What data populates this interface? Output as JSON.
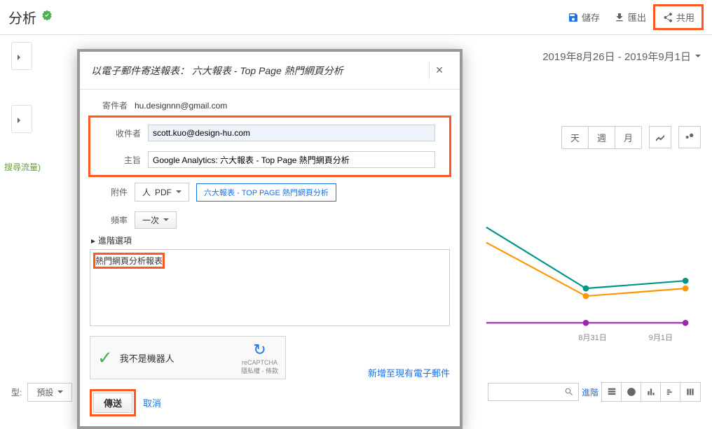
{
  "header": {
    "title": "分析",
    "save": "儲存",
    "export": "匯出",
    "share": "共用"
  },
  "date_range": "2019年8月26日 - 2019年9月1日",
  "segments": {
    "day": "天",
    "week": "週",
    "month": "月"
  },
  "legend": "搜尋流量)",
  "x_labels": [
    "8月31日",
    "9月1日"
  ],
  "bottom": {
    "type_label": "型:",
    "type_value": "預設",
    "advanced": "進階"
  },
  "modal": {
    "title_prefix": "以電子郵件寄送報表：",
    "title_report": "六大報表 - Top Page 熱門網頁分析",
    "labels": {
      "from": "寄件者",
      "to": "收件者",
      "subject": "主旨",
      "attachment": "附件",
      "frequency": "頻率"
    },
    "from_value": "hu.designnn@gmail.com",
    "to_value": "scott.kuo@design-hu.com",
    "subject_value": "Google Analytics: 六大報表 - Top Page 熱門網頁分析",
    "pdf": "PDF",
    "attachment_badge": "六大報表 - TOP PAGE 熱門網頁分析",
    "frequency_value": "一次",
    "advanced": "進階選項",
    "message": "熱門網頁分析報表",
    "recaptcha": {
      "text": "我不是機器人",
      "brand": "reCAPTCHA",
      "footer": "隱私權 - 條款"
    },
    "add_link": "新增至現有電子郵件",
    "send": "傳送",
    "cancel": "取消"
  }
}
